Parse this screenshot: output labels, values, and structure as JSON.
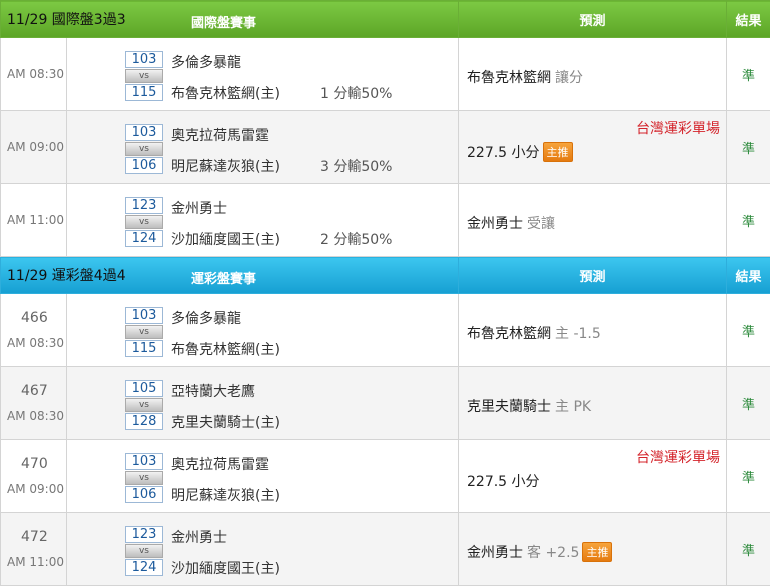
{
  "intl": {
    "header": {
      "title": "11/29 國際盤3過3",
      "event_col": "國際盤賽事",
      "predict_col": "預測",
      "result_col": "結果"
    },
    "rows": [
      {
        "game_no": "",
        "time": "AM 08:30",
        "away_score": "103",
        "home_score": "115",
        "vs": "vs",
        "away_team": "多倫多暴龍",
        "home_team": "布魯克林籃網(主)",
        "handicap": "1 分輸50%",
        "pick": "布魯克林籃網",
        "pick_extra": "讓分",
        "badge": "",
        "tag": "",
        "result": "準"
      },
      {
        "game_no": "",
        "time": "AM 09:00",
        "away_score": "103",
        "home_score": "106",
        "vs": "vs",
        "away_team": "奧克拉荷馬雷霆",
        "home_team": "明尼蘇達灰狼(主)",
        "handicap": "3 分輸50%",
        "pick": "227.5 小分",
        "pick_extra": "",
        "badge": "主推",
        "tag": "台灣運彩單場",
        "result": "準"
      },
      {
        "game_no": "",
        "time": "AM 11:00",
        "away_score": "123",
        "home_score": "124",
        "vs": "vs",
        "away_team": "金州勇士",
        "home_team": "沙加緬度國王(主)",
        "handicap": "2 分輸50%",
        "pick": "金州勇士",
        "pick_extra": "受讓",
        "badge": "",
        "tag": "",
        "result": "準"
      }
    ]
  },
  "sports": {
    "header": {
      "title": "11/29 運彩盤4過4",
      "event_col": "運彩盤賽事",
      "predict_col": "預測",
      "result_col": "結果"
    },
    "rows": [
      {
        "game_no": "466",
        "time": "AM 08:30",
        "away_score": "103",
        "home_score": "115",
        "vs": "vs",
        "away_team": "多倫多暴龍",
        "home_team": "布魯克林籃網(主)",
        "handicap": "",
        "pick": "布魯克林籃網",
        "pick_extra": "主 -1.5",
        "badge": "",
        "tag": "",
        "result": "準"
      },
      {
        "game_no": "467",
        "time": "AM 08:30",
        "away_score": "105",
        "home_score": "128",
        "vs": "vs",
        "away_team": "亞特蘭大老鷹",
        "home_team": "克里夫蘭騎士(主)",
        "handicap": "",
        "pick": "克里夫蘭騎士",
        "pick_extra": "主 PK",
        "badge": "",
        "tag": "",
        "result": "準"
      },
      {
        "game_no": "470",
        "time": "AM 09:00",
        "away_score": "103",
        "home_score": "106",
        "vs": "vs",
        "away_team": "奧克拉荷馬雷霆",
        "home_team": "明尼蘇達灰狼(主)",
        "handicap": "",
        "pick": "227.5 小分",
        "pick_extra": "",
        "badge": "",
        "tag": "台灣運彩單場",
        "result": "準"
      },
      {
        "game_no": "472",
        "time": "AM 11:00",
        "away_score": "123",
        "home_score": "124",
        "vs": "vs",
        "away_team": "金州勇士",
        "home_team": "沙加緬度國王(主)",
        "handicap": "",
        "pick": "金州勇士",
        "pick_extra": "客 +2.5",
        "badge": "主推",
        "tag": "",
        "result": "準"
      }
    ]
  },
  "colors": {
    "green_header": "#6aaf36",
    "blue_header": "#169fd2",
    "tag_red": "#d4242b",
    "result_green": "#2e8b3d",
    "badge_orange": "#e57a10"
  }
}
